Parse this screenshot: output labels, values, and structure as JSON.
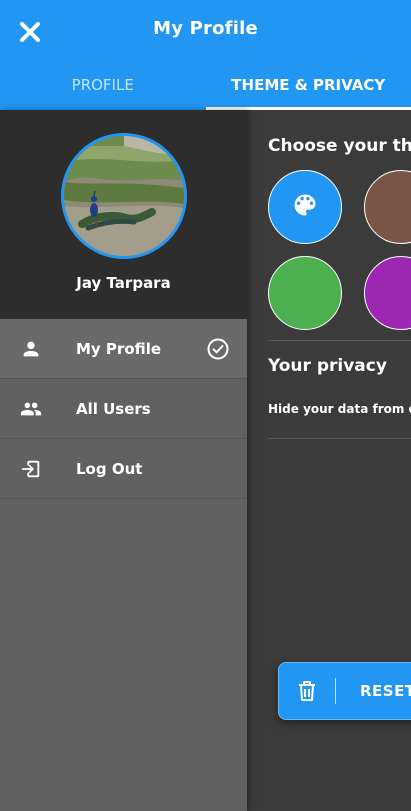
{
  "header": {
    "title": "My Profile",
    "tabs": [
      {
        "label": "PROFILE",
        "active": false
      },
      {
        "label": "THEME & PRIVACY",
        "active": true
      }
    ],
    "bg_color": "#2196f3"
  },
  "theme": {
    "title": "Choose your theme",
    "swatches": [
      {
        "color": "#2196f3",
        "icon": "palette-icon",
        "selected": true
      },
      {
        "color": "#795548",
        "icon": "",
        "selected": false
      },
      {
        "color": "#4caf50",
        "icon": "",
        "selected": false
      },
      {
        "color": "#9c27b0",
        "icon": "",
        "selected": false
      }
    ]
  },
  "privacy": {
    "title": "Your privacy",
    "description": "Hide your data from others"
  },
  "reset_button": {
    "label": "RESET",
    "icon": "trash-icon"
  },
  "drawer": {
    "user_name": "Jay Tarpara",
    "items": [
      {
        "label": "My Profile",
        "icon": "person-icon",
        "active": true,
        "trailing_icon": "check-circle-icon"
      },
      {
        "label": "All Users",
        "icon": "people-icon",
        "active": false
      },
      {
        "label": "Log Out",
        "icon": "logout-icon",
        "active": false
      }
    ]
  }
}
